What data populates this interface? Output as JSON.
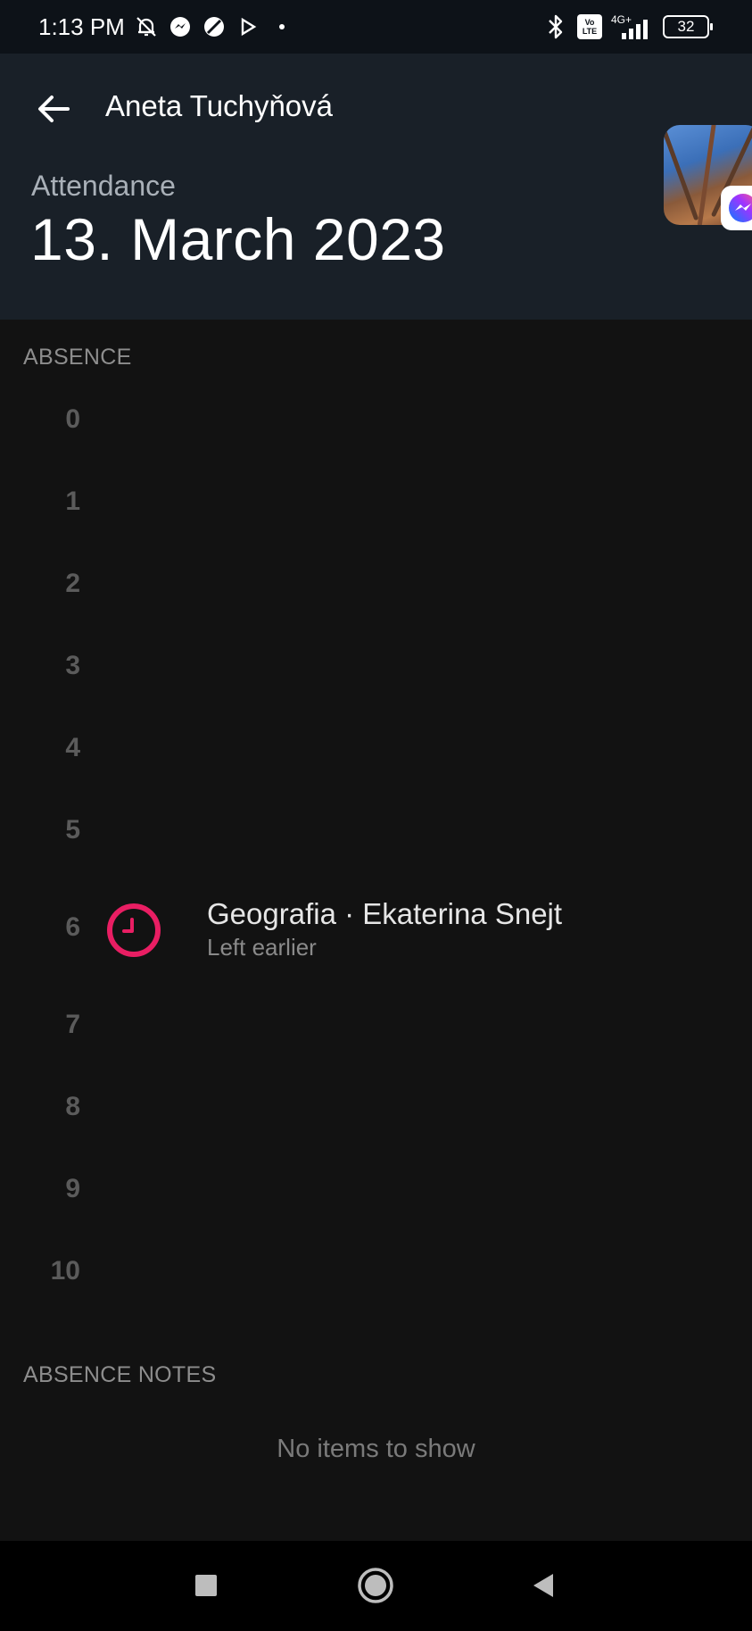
{
  "status_bar": {
    "time": "1:13 PM",
    "left_icons": [
      "bell-off-icon",
      "messenger-icon",
      "no-entry-icon",
      "play-store-icon",
      "dot-icon"
    ],
    "right_icons": [
      "bluetooth-icon",
      "volte-icon",
      "network-4g-icon",
      "signal-icon"
    ],
    "network_label": "4G+",
    "volte_label": "Vo LTE",
    "battery": "32"
  },
  "header": {
    "title": "Aneta Tuchyňová",
    "subtitle": "Attendance",
    "date": "13. March 2023"
  },
  "absence": {
    "section_label": "ABSENCE",
    "lessons": [
      "0",
      "1",
      "2",
      "3",
      "4",
      "5",
      "6",
      "7",
      "8",
      "9",
      "10"
    ],
    "entry": {
      "lesson": "6",
      "title": "Geografia · Ekaterina Snejt",
      "status": "Left earlier",
      "icon": "clock-icon",
      "color": "#e91e63"
    }
  },
  "notes": {
    "section_label": "ABSENCE NOTES",
    "empty_text": "No items to show"
  },
  "nav_bar": {
    "buttons": [
      "recents-button",
      "home-button",
      "back-button"
    ]
  }
}
